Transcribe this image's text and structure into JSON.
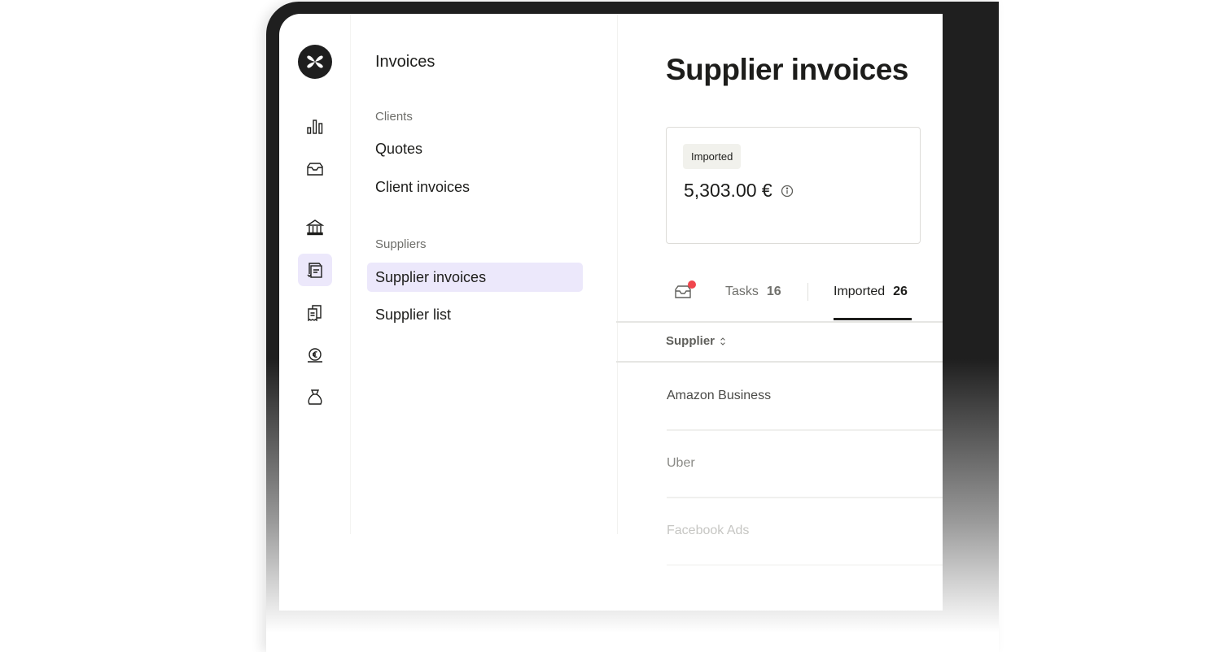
{
  "rail": {
    "logo": "brand-logo",
    "items": [
      {
        "icon": "bar-chart-icon",
        "active": false
      },
      {
        "icon": "inbox-tray-icon",
        "active": false
      },
      {
        "icon": "bank-icon",
        "active": false
      },
      {
        "icon": "invoice-exchange-icon",
        "active": true
      },
      {
        "icon": "receipts-icon",
        "active": false
      },
      {
        "icon": "euro-coin-icon",
        "active": false
      },
      {
        "icon": "money-bag-icon",
        "active": false
      }
    ]
  },
  "submenu": {
    "title": "Invoices",
    "sections": [
      {
        "label": "Clients",
        "items": [
          "Quotes",
          "Client invoices"
        ]
      },
      {
        "label": "Suppliers",
        "items": [
          "Supplier invoices",
          "Supplier list"
        ]
      }
    ],
    "active_item": "Supplier invoices"
  },
  "main": {
    "title": "Supplier invoices",
    "summary_card": {
      "badge": "Imported",
      "amount": "5,303.00 €"
    },
    "tabs": [
      {
        "label": "Tasks",
        "count": "16",
        "active": false
      },
      {
        "label": "Imported",
        "count": "26",
        "active": true
      }
    ],
    "table": {
      "columns": [
        {
          "label": "Supplier",
          "sortable": true
        }
      ],
      "rows": [
        {
          "supplier": "Amazon Business"
        },
        {
          "supplier": "Uber"
        },
        {
          "supplier": "Facebook Ads"
        }
      ]
    }
  },
  "colors": {
    "accent_bg": "#ece8fb",
    "notification_dot": "#f0464d",
    "text_primary": "#1d1d1b",
    "text_secondary": "#6f6f6b"
  }
}
